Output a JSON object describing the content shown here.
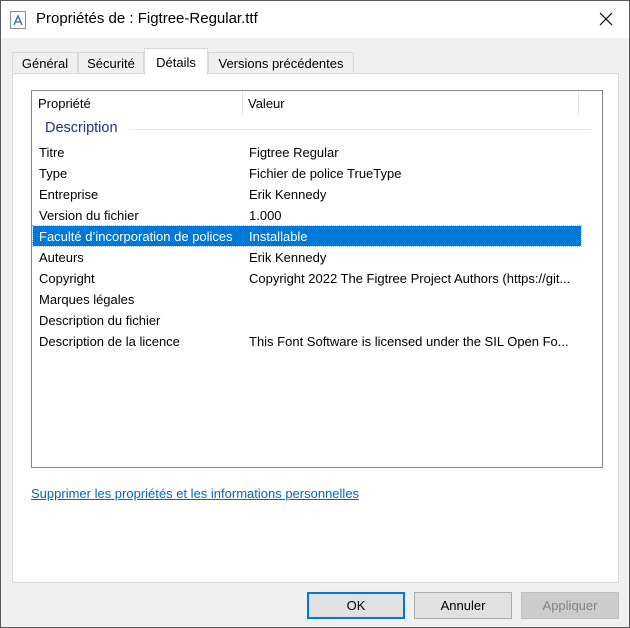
{
  "window": {
    "title": "Propriétés de : Figtree-Regular.ttf"
  },
  "tabs": [
    {
      "label": "Général"
    },
    {
      "label": "Sécurité"
    },
    {
      "label": "Détails"
    },
    {
      "label": "Versions précédentes"
    }
  ],
  "active_tab": "Détails",
  "list": {
    "columns": [
      "Propriété",
      "Valeur"
    ],
    "group": "Description",
    "rows": [
      {
        "key": "Titre",
        "value": "Figtree Regular"
      },
      {
        "key": "Type",
        "value": "Fichier de police TrueType"
      },
      {
        "key": "Entreprise",
        "value": "Erik Kennedy"
      },
      {
        "key": "Version du fichier",
        "value": "1.000"
      },
      {
        "key": "Faculté d’incorporation de polices",
        "value": "Installable"
      },
      {
        "key": "Auteurs",
        "value": "Erik Kennedy"
      },
      {
        "key": "Copyright",
        "value": "Copyright 2022 The Figtree Project Authors (https://git..."
      },
      {
        "key": "Marques légales",
        "value": ""
      },
      {
        "key": "Description du fichier",
        "value": ""
      },
      {
        "key": "Description de la licence",
        "value": "This Font Software is licensed under the SIL Open Fo..."
      }
    ],
    "selected_row": 4
  },
  "link_label": "Supprimer les propriétés et les informations personnelles",
  "buttons": {
    "ok": "OK",
    "cancel": "Annuler",
    "apply": "Appliquer"
  },
  "colors": {
    "selection": "#0078d7",
    "link": "#0066cc",
    "group_title": "#1e3287"
  },
  "icons": {
    "title": "font-file-icon",
    "close": "close-icon"
  }
}
